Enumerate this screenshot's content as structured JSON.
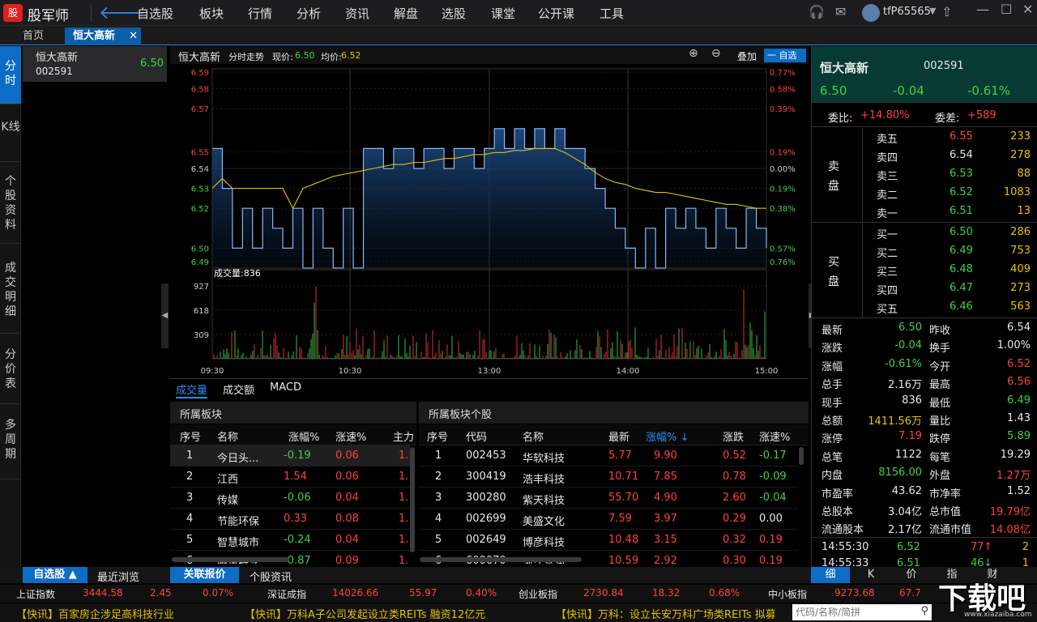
{
  "app": {
    "logo": "股",
    "name": "股军师",
    "user": "tfP65565"
  },
  "menu": [
    "自选股",
    "板块",
    "行情",
    "分析",
    "资讯",
    "解盘",
    "选股",
    "课堂",
    "公开课",
    "工具"
  ],
  "tabs": {
    "home": "首页",
    "stock": "恒大高新"
  },
  "vtabs": [
    "分时",
    "K线",
    "个股资料",
    "成交明细",
    "分价表",
    "多周期"
  ],
  "watch": {
    "name": "恒大高新",
    "code": "002591",
    "price": "6.50"
  },
  "chart": {
    "name": "恒大高新",
    "mode": "分时走势",
    "price_label": "现价:",
    "price": "6.50",
    "avg_label": "均价:",
    "avg": "6.52",
    "overlay": "叠加",
    "add_watch": "一 自选",
    "vol_label": "成交量:836",
    "btabs": [
      "成交量",
      "成交额",
      "MACD"
    ]
  },
  "chart_data": {
    "type": "line",
    "y_left": [
      "6.59",
      "6.58",
      "6.57",
      "6.55",
      "6.54",
      "6.53",
      "6.52",
      "6.50",
      "6.49"
    ],
    "y_right": [
      "0.77%",
      "0.58%",
      "0.39%",
      "0.19%",
      "0.00%",
      "0.19%",
      "0.38%",
      "0.57%",
      "0.76%"
    ],
    "x": [
      "09:30",
      "10:30",
      "13:00",
      "14:00",
      "15:00"
    ],
    "vol_ticks": [
      "927",
      "618",
      "309"
    ],
    "price": [
      6.55,
      6.53,
      6.5,
      6.52,
      6.5,
      6.52,
      6.51,
      6.5,
      6.52,
      6.49,
      6.52,
      6.5,
      6.49,
      6.52,
      6.49,
      6.55,
      6.55,
      6.54,
      6.55,
      6.55,
      6.54,
      6.55,
      6.55,
      6.54,
      6.55,
      6.55,
      6.54,
      6.55,
      6.56,
      6.55,
      6.56,
      6.55,
      6.56,
      6.55,
      6.56,
      6.55,
      6.55,
      6.54,
      6.53,
      6.52,
      6.51,
      6.5,
      6.49,
      6.51,
      6.49,
      6.52,
      6.51,
      6.52,
      6.51,
      6.5,
      6.52,
      6.51,
      6.5,
      6.52,
      6.51,
      6.5
    ],
    "avg": [
      6.53,
      6.535,
      6.53,
      6.53,
      6.53,
      6.53,
      6.53,
      6.53,
      6.52,
      6.53,
      6.532,
      6.534,
      6.536,
      6.537,
      6.538,
      6.539,
      6.54,
      6.541,
      6.542,
      6.542,
      6.543,
      6.543,
      6.544,
      6.545,
      6.545,
      6.546,
      6.547,
      6.547,
      6.548,
      6.548,
      6.549,
      6.549,
      6.55,
      6.55,
      6.55,
      6.548,
      6.545,
      6.542,
      6.538,
      6.535,
      6.533,
      6.532,
      6.53,
      6.529,
      6.528,
      6.528,
      6.527,
      6.526,
      6.525,
      6.524,
      6.523,
      6.522,
      6.522,
      6.521,
      6.52,
      6.52
    ]
  },
  "sector": {
    "title": "所属板块",
    "headers": [
      "序号",
      "名称",
      "涨幅%",
      "涨速%",
      "主力"
    ],
    "rows": [
      [
        "1",
        "今日头...",
        "-0.19",
        "0.06",
        "1."
      ],
      [
        "2",
        "江西",
        "1.54",
        "0.06",
        "1."
      ],
      [
        "3",
        "传媒",
        "-0.06",
        "0.04",
        "1."
      ],
      [
        "4",
        "节能环保",
        "0.33",
        "0.08",
        "1."
      ],
      [
        "5",
        "智慧城市",
        "-0.24",
        "0.04",
        "1."
      ],
      [
        "6",
        "腾讯概念",
        "-0.87",
        "0.09",
        "1."
      ]
    ]
  },
  "stocks": {
    "title": "所属板块个股",
    "headers": [
      "序号",
      "代码",
      "名称",
      "最新",
      "涨幅%",
      "涨跌",
      "涨速%"
    ],
    "rows": [
      [
        "1",
        "002453",
        "华软科技",
        "5.77",
        "9.90",
        "0.52",
        "-0.17"
      ],
      [
        "2",
        "300419",
        "浩丰科技",
        "10.71",
        "7.85",
        "0.78",
        "-0.09"
      ],
      [
        "3",
        "300280",
        "紫天科技",
        "55.70",
        "4.90",
        "2.60",
        "-0.04"
      ],
      [
        "4",
        "002699",
        "美盛文化",
        "7.59",
        "3.97",
        "0.29",
        "0.00"
      ],
      [
        "5",
        "002649",
        "博彦科技",
        "10.48",
        "3.15",
        "0.32",
        "0.19"
      ],
      [
        "6",
        "600070",
        "浙江富润",
        "10.59",
        "2.92",
        "0.30",
        "0.19"
      ]
    ]
  },
  "quote": {
    "name": "恒大高新",
    "code": "002591",
    "price": "6.50",
    "change": "-0.04",
    "pct": "-0.61%",
    "weibi_label": "委比:",
    "weibi": "+14.80%",
    "weicha_label": "委差:",
    "weicha": "+589",
    "sell_label": "卖盘",
    "buy_label": "买盘",
    "asks": [
      [
        "卖五",
        "6.55",
        "233"
      ],
      [
        "卖四",
        "6.54",
        "278"
      ],
      [
        "卖三",
        "6.53",
        "88"
      ],
      [
        "卖二",
        "6.52",
        "1083"
      ],
      [
        "卖一",
        "6.51",
        "13"
      ]
    ],
    "bids": [
      [
        "买一",
        "6.50",
        "286"
      ],
      [
        "买二",
        "6.49",
        "753"
      ],
      [
        "买三",
        "6.48",
        "409"
      ],
      [
        "买四",
        "6.47",
        "273"
      ],
      [
        "买五",
        "6.46",
        "563"
      ]
    ],
    "stats": [
      [
        "最新",
        "6.50",
        "昨收",
        "6.54"
      ],
      [
        "涨跌",
        "-0.04",
        "换手",
        "1.00%"
      ],
      [
        "涨幅",
        "-0.61%",
        "今开",
        "6.52"
      ],
      [
        "总手",
        "2.16万",
        "最高",
        "6.56"
      ],
      [
        "现手",
        "836",
        "最低",
        "6.49"
      ],
      [
        "总额",
        "1411.56万",
        "量比",
        "1.43"
      ],
      [
        "涨停",
        "7.19",
        "跌停",
        "5.89"
      ],
      [
        "总笔",
        "1122",
        "每笔",
        "19.29"
      ],
      [
        "内盘",
        "8156.00",
        "外盘",
        "1.27万"
      ],
      [
        "市盈率",
        "43.62",
        "市净率",
        "1.52"
      ],
      [
        "总股本",
        "3.04亿",
        "总市值",
        "19.79亿"
      ],
      [
        "流通股本",
        "2.17亿",
        "流通市值",
        "14.08亿"
      ]
    ],
    "ticks": [
      [
        "14:55:30",
        "6.52",
        "77",
        "↑",
        "2"
      ],
      [
        "14:55:33",
        "6.51",
        "46",
        "↓",
        "1"
      ]
    ],
    "rtabs": [
      "细",
      "K",
      "价",
      "指",
      "财"
    ]
  },
  "bottomtabs": {
    "watch": "自选股",
    "recent": "最近浏览",
    "related": "关联报价",
    "info": "个股资讯"
  },
  "indices": [
    [
      "上证指数",
      "3444.58",
      "2.45",
      "0.07%"
    ],
    [
      "深证成指",
      "14026.66",
      "55.97",
      "0.40%"
    ],
    [
      "创业板指",
      "2730.84",
      "18.32",
      "0.68%"
    ],
    [
      "中小板指",
      "9273.68",
      "67.7"
    ]
  ],
  "news": [
    "【快讯】百家房企涉足高科技行业",
    "【快讯】万科A子公司发起设立类REITs 融资12亿元",
    "【快讯】万科：设立长安万科广场类REITs 拟募"
  ],
  "search": {
    "placeholder": "代码/名称/简拼"
  },
  "watermark": "下载吧",
  "watermark_url": "www.xiazaiba.com"
}
